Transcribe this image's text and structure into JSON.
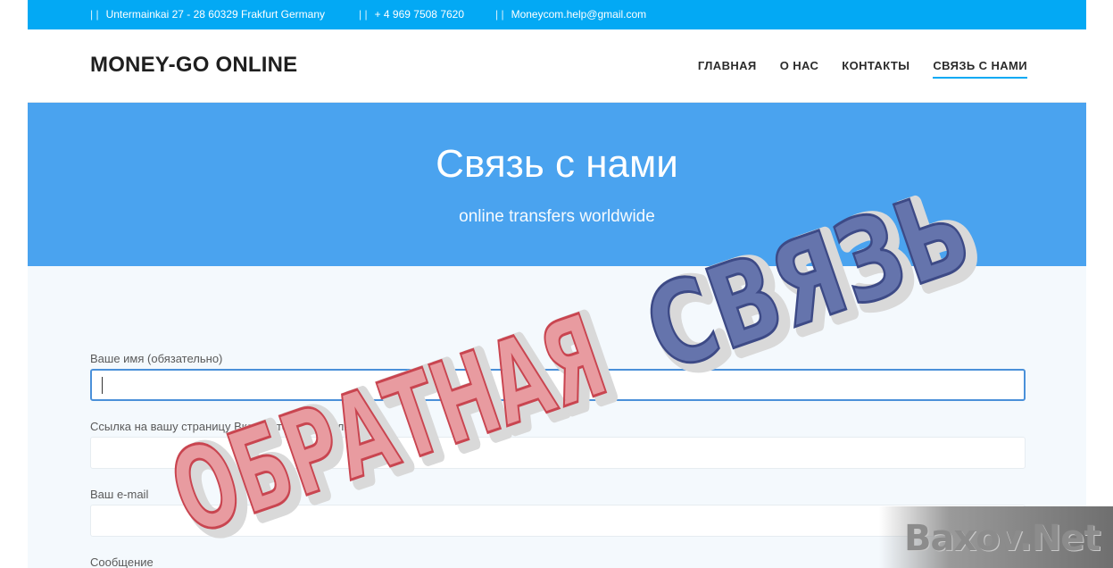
{
  "topbar": {
    "address": "Untermainkai 27 - 28 60329 Frakfurt Germany",
    "phone": "+ 4 969 7508 7620",
    "email": "Moneycom.help@gmail.com",
    "separator": "| |"
  },
  "header": {
    "logo": "MONEY-GO ONLINE",
    "nav": [
      {
        "label": "ГЛАВНАЯ"
      },
      {
        "label": "О НАС"
      },
      {
        "label": "КОНТАКТЫ"
      },
      {
        "label": "СВЯЗЬ С НАМИ",
        "active": true
      }
    ]
  },
  "hero": {
    "title": "Связь с нами",
    "subtitle": "online transfers worldwide"
  },
  "form": {
    "name_label": "Ваше имя (обязательно)",
    "vk_label": "Ссылка на вашу страницу Вконтакте (обязательно)",
    "email_label": "Ваш e-mail",
    "message_label": "Сообщение"
  },
  "overlay": {
    "stamp_word1": "ОБРАТНАЯ",
    "stamp_word2": "СВЯЗЬ",
    "brand": "Baxov.Net"
  },
  "colors": {
    "topbar": "#03a9f4",
    "hero": "#4aa3ef",
    "stamp_red": "#e9969b",
    "stamp_blue": "#5b6ba8"
  }
}
